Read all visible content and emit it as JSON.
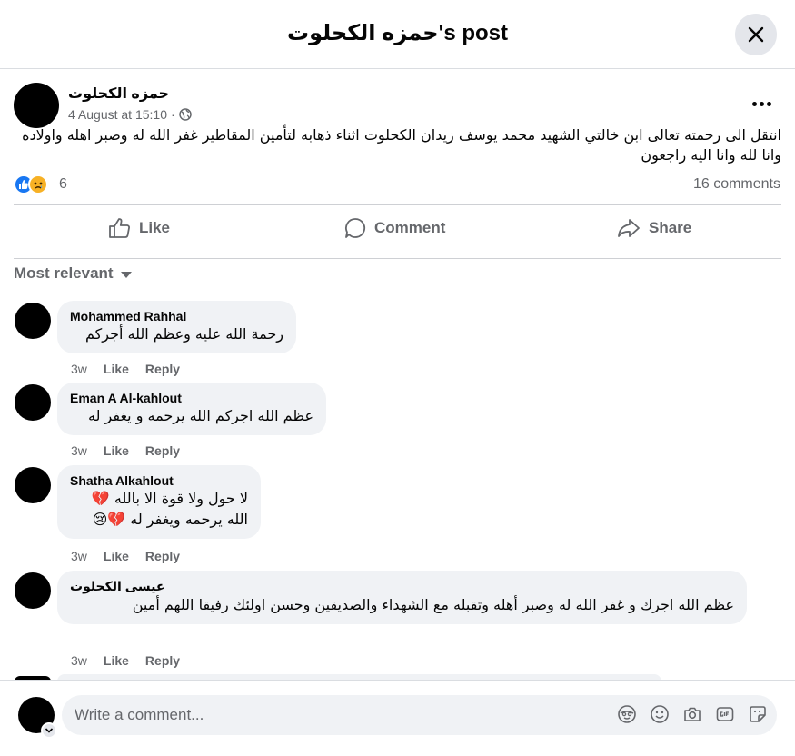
{
  "header": {
    "title": "حمزه الكحلوت's post"
  },
  "post": {
    "author": "حمزه الكحلوت",
    "timestamp": "4 August at 15:10",
    "meta_separator": "·",
    "privacy_icon": "globe-icon",
    "text": "انتقل الى رحمته تعالى ابن خالتي الشهيد محمد يوسف زيدان الكحلوت اثناء ذهابه لتأمين المقاطير غفر الله له وصبر اهله واولاده وانا لله وانا اليه راجعون",
    "reaction_count": "6",
    "reaction_icons": [
      "like-reaction-icon",
      "sad-reaction-icon"
    ],
    "comments_count": "16 comments"
  },
  "actions": {
    "like": "Like",
    "comment": "Comment",
    "share": "Share"
  },
  "sort": {
    "label": "Most relevant"
  },
  "comments": [
    {
      "name": "Mohammed Rahhal",
      "lines": [
        "رحمة الله عليه وعظم الله أجركم"
      ],
      "time": "3w",
      "like": "Like",
      "reply": "Reply"
    },
    {
      "name": "Eman A Al-kahlout",
      "lines": [
        "عظم الله اجركم الله يرحمه و يغفر له"
      ],
      "time": "3w",
      "like": "Like",
      "reply": "Reply"
    },
    {
      "name": "Shatha Alkahlout",
      "lines": [
        "لا حول ولا قوة الا بالله 💔",
        "الله يرحمه ويغفر له 💔😢"
      ],
      "time": "3w",
      "like": "Like",
      "reply": "Reply"
    },
    {
      "name": "عيسى الكحلوت",
      "lines": [
        "عظم الله اجرك و غفر الله له وصبر أهله وتقبله مع الشهداء والصديقين وحسن اولئك رفيقا اللهم أمين"
      ],
      "time": "3w",
      "like": "Like",
      "reply": "Reply"
    }
  ],
  "composer": {
    "placeholder": "Write a comment...",
    "icons": [
      "avatar-sticker-icon",
      "emoji-icon",
      "camera-icon",
      "gif-icon",
      "sticker-icon"
    ]
  },
  "colors": {
    "accent": "#1877f2",
    "secondary_text": "#65676b",
    "bubble_bg": "#f0f2f5",
    "sad_reaction": "#f7b125"
  }
}
